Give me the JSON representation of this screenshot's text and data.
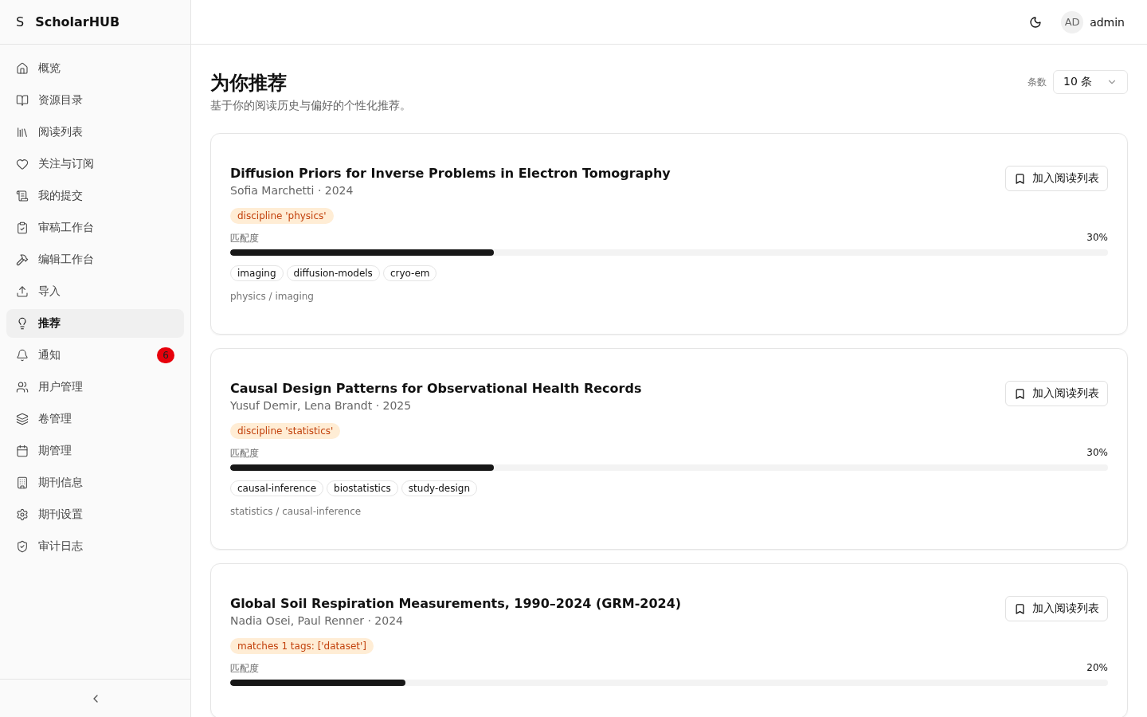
{
  "brand": {
    "logo": "S",
    "name": "ScholarHUB"
  },
  "nav": [
    {
      "label": "概览",
      "selected": false
    },
    {
      "label": "资源目录",
      "selected": false
    },
    {
      "label": "阅读列表",
      "selected": false
    },
    {
      "label": "关注与订阅",
      "selected": false
    },
    {
      "label": "我的提交",
      "selected": false
    },
    {
      "label": "审稿工作台",
      "selected": false
    },
    {
      "label": "编辑工作台",
      "selected": false
    },
    {
      "label": "导入",
      "selected": false
    },
    {
      "label": "推荐",
      "selected": true
    },
    {
      "label": "通知",
      "selected": false,
      "badge": "6"
    },
    {
      "label": "用户管理",
      "selected": false
    },
    {
      "label": "卷管理",
      "selected": false
    },
    {
      "label": "期管理",
      "selected": false
    },
    {
      "label": "期刊信息",
      "selected": false
    },
    {
      "label": "期刊设置",
      "selected": false
    },
    {
      "label": "审计日志",
      "selected": false
    }
  ],
  "user": {
    "initials": "AD",
    "name": "admin"
  },
  "page": {
    "title": "为你推荐",
    "subtitle": "基于你的阅读历史与偏好的个性化推荐。",
    "count_label": "条数",
    "count_value": "10 条"
  },
  "recommendations": [
    {
      "title": "Diffusion Priors for Inverse Problems in Electron Tomography",
      "meta": "Sofia Marchetti · 2024",
      "reason": "discipline 'physics'",
      "match_label": "匹配度",
      "level": 0.3,
      "reading": "30%",
      "tags": [
        "imaging",
        "diffusion-models",
        "cryo-em"
      ],
      "path": "physics / imaging",
      "action": "加入阅读列表"
    },
    {
      "title": "Causal Design Patterns for Observational Health Records",
      "meta": "Yusuf Demir, Lena Brandt · 2025",
      "reason": "discipline 'statistics'",
      "match_label": "匹配度",
      "level": 0.3,
      "reading": "30%",
      "tags": [
        "causal-inference",
        "biostatistics",
        "study-design"
      ],
      "path": "statistics / causal-inference",
      "action": "加入阅读列表"
    },
    {
      "title": "Global Soil Respiration Measurements, 1990–2024 (GRM-2024)",
      "meta": "Nadia Osei, Paul Renner · 2024",
      "reason": "matches 1 tags: ['dataset']",
      "match_label": "匹配度",
      "level": 0.2,
      "reading": "20%",
      "action": "加入阅读列表"
    }
  ]
}
